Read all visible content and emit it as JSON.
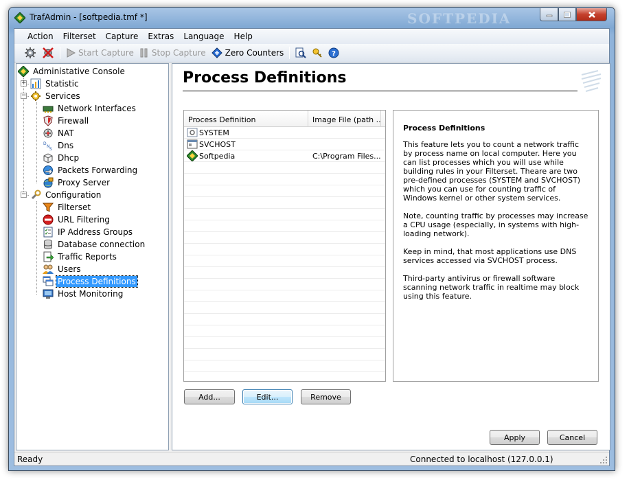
{
  "window": {
    "title": "TrafAdmin - [softpedia.tmf *]",
    "watermark": "SOFTPEDIA"
  },
  "menu": [
    "Action",
    "Filterset",
    "Capture",
    "Extras",
    "Language",
    "Help"
  ],
  "toolbar": {
    "start_capture": "Start Capture",
    "stop_capture": "Stop Capture",
    "zero_counters": "Zero Counters"
  },
  "tree": {
    "root": "Administative Console",
    "statistic": "Statistic",
    "services": "Services",
    "services_children": [
      "Network Interfaces",
      "Firewall",
      "NAT",
      "Dns",
      "Dhcp",
      "Packets Forwarding",
      "Proxy Server"
    ],
    "configuration": "Configuration",
    "configuration_children": [
      "Filterset",
      "URL Filtering",
      "IP Address Groups",
      "Database connection",
      "Traffic Reports",
      "Users",
      "Process Definitions",
      "Host Monitoring"
    ],
    "selected": "Process Definitions"
  },
  "main": {
    "title": "Process Definitions",
    "columns": [
      "Process Definition",
      "Image File (path ..."
    ],
    "rows": [
      {
        "name": "SYSTEM",
        "path": "",
        "icon": "gear-window-icon"
      },
      {
        "name": "SVCHOST",
        "path": "",
        "icon": "window-icon"
      },
      {
        "name": "Softpedia",
        "path": "C:\\Program Files...",
        "icon": "diamond-icon"
      }
    ],
    "description": {
      "title": "Process Definitions",
      "p1": "This feature lets you to count a network traffic by process name on local computer. Here you can list processes which you will use while building rules in your Filterset. Theare are two pre-defined processes (SYSTEM and SVCHOST) which you can use for counting traffic of Windows kernel or other system services.",
      "p2": "Note, counting traffic by processes may increase a CPU usage (especially, in systems with high-loading network).",
      "p3": "Keep in mind, that most applications use DNS services accessed via SVCHOST process.",
      "p4": "Third-party antivirus or firewall software scanning network traffic in realtime may block using this feature."
    },
    "buttons": {
      "add": "Add...",
      "edit": "Edit...",
      "remove": "Remove",
      "apply": "Apply",
      "cancel": "Cancel"
    }
  },
  "status": {
    "left": "Ready",
    "right": "Connected to localhost (127.0.0.1)"
  },
  "colors": {
    "selection": "#3399ff",
    "title_bar": "#8fb3da",
    "close_button": "#c4402c"
  }
}
